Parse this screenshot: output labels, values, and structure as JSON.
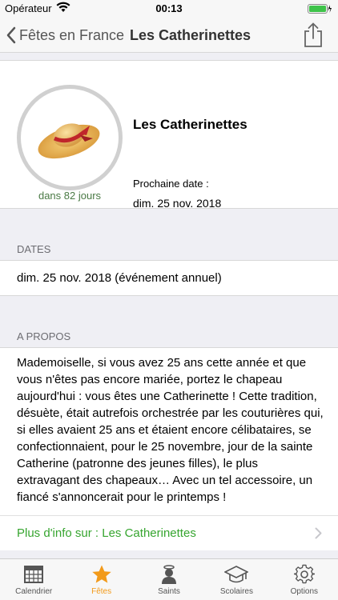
{
  "status_bar": {
    "carrier": "Opérateur",
    "time": "00:13"
  },
  "nav": {
    "back_label": "Fêtes en France",
    "title": "Les Catherinettes"
  },
  "event": {
    "title": "Les Catherinettes",
    "countdown": "dans 82 jours",
    "next_label": "Prochaine date :",
    "next_date": "dim. 25 nov. 2018"
  },
  "dates_section": {
    "header": "DATES",
    "row": "dim. 25 nov. 2018 (événement annuel)"
  },
  "about_section": {
    "header": "A PROPOS",
    "text": "Mademoiselle, si vous avez 25 ans cette année et que vous n'êtes pas encore mariée, portez le chapeau aujourd'hui : vous êtes une Catherinette ! Cette tradition, désuète, était autrefois orchestrée par les couturières qui, si elles avaient 25 ans et étaient encore célibataires, se confectionnaient, pour le 25 novembre, jour de la sainte Catherine (patronne des jeunes filles), le plus extravagant des chapeaux… Avec un tel accessoire, un fiancé s'annoncerait pour le printemps !",
    "more_link": "Plus d'info sur : Les Catherinettes"
  },
  "tabs": [
    {
      "label": "Calendrier",
      "icon": "calendar-icon",
      "active": false
    },
    {
      "label": "Fêtes",
      "icon": "star-icon",
      "active": true
    },
    {
      "label": "Saints",
      "icon": "saint-icon",
      "active": false
    },
    {
      "label": "Scolaires",
      "icon": "graduation-cap-icon",
      "active": false
    },
    {
      "label": "Options",
      "icon": "gear-icon",
      "active": false
    }
  ],
  "colors": {
    "accent": "#f29a1a",
    "link_green": "#36a52f",
    "countdown_green": "#4a7a45"
  }
}
